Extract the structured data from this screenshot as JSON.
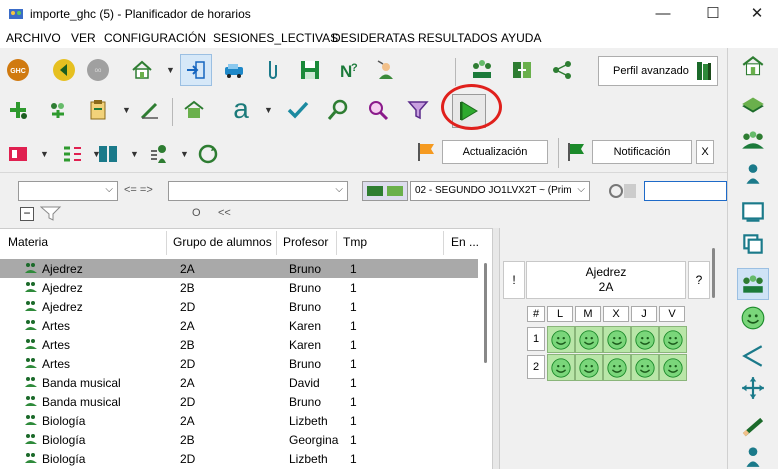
{
  "window": {
    "title": "importe_ghc (5) - Planificador de horarios",
    "minimize": "—",
    "maximize": "☐",
    "close": "✕"
  },
  "menu": [
    "ARCHIVO",
    "VER",
    "CONFIGURACIÓN",
    "SESIONES_LECTIVAS",
    "DESIDERATAS",
    "RESULTADOS",
    "AYUDA"
  ],
  "toolbar": {
    "ghc_label": "GHC",
    "perfil_label": "Perfil avanzado",
    "a_label": "a",
    "actualizacion_label": "Actualización",
    "notificacion_label": "Notificación",
    "x_label": "X"
  },
  "filter": {
    "op_label": "<= =>",
    "o_label": "O",
    "back_label": "<<",
    "minus_label": "−",
    "group_combo": "02 - SEGUNDO JO1LVX2T ~ (Prim"
  },
  "table": {
    "columns": [
      "Materia",
      "Grupo de alumnos",
      "Profesor",
      "Tmp",
      "En ..."
    ],
    "rows": [
      {
        "materia": "Ajedrez",
        "grupo": "2A",
        "profesor": "Bruno",
        "tmp": "1"
      },
      {
        "materia": "Ajedrez",
        "grupo": "2B",
        "profesor": "Bruno",
        "tmp": "1"
      },
      {
        "materia": "Ajedrez",
        "grupo": "2D",
        "profesor": "Bruno",
        "tmp": "1"
      },
      {
        "materia": "Artes",
        "grupo": "2A",
        "profesor": "Karen",
        "tmp": "1"
      },
      {
        "materia": "Artes",
        "grupo": "2B",
        "profesor": "Karen",
        "tmp": "1"
      },
      {
        "materia": "Artes",
        "grupo": "2D",
        "profesor": "Bruno",
        "tmp": "1"
      },
      {
        "materia": "Banda musical",
        "grupo": "2A",
        "profesor": "David",
        "tmp": "1"
      },
      {
        "materia": "Banda musical",
        "grupo": "2D",
        "profesor": "Bruno",
        "tmp": "1"
      },
      {
        "materia": "Biología",
        "grupo": "2A",
        "profesor": "Lizbeth",
        "tmp": "1"
      },
      {
        "materia": "Biología",
        "grupo": "2B",
        "profesor": "Georgina",
        "tmp": "1"
      },
      {
        "materia": "Biología",
        "grupo": "2D",
        "profesor": "Lizbeth",
        "tmp": "1"
      }
    ]
  },
  "detail": {
    "lesson_name": "Ajedrez",
    "lesson_group": "2A",
    "left_btn": "!",
    "right_btn": "?",
    "corner": "#",
    "days": [
      "L",
      "M",
      "X",
      "J",
      "V"
    ],
    "periods": [
      "1",
      "2"
    ]
  },
  "colors": {
    "selected_row": "#a9a9a9",
    "slot_green": "#b9e6a8",
    "highlight_circle": "#e0201c"
  }
}
